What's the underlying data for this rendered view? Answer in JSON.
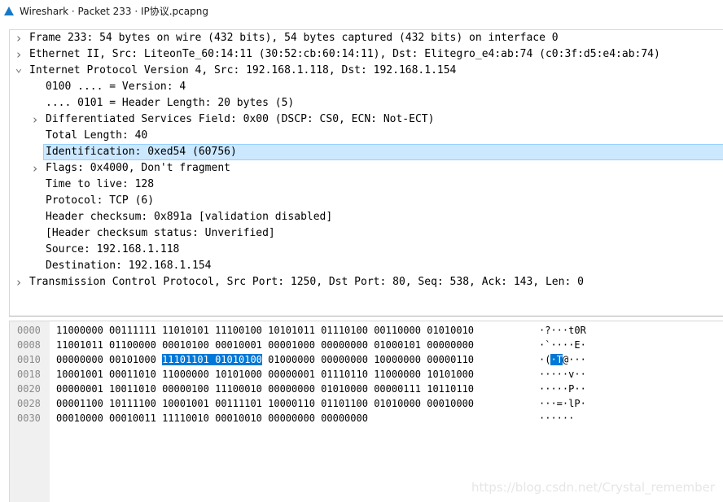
{
  "window": {
    "title": "Wireshark · Packet 233 · IP协议.pcapng"
  },
  "tree": [
    {
      "level": 0,
      "arrow": "collapsed",
      "text": "Frame 233: 54 bytes on wire (432 bits), 54 bytes captured (432 bits) on interface 0"
    },
    {
      "level": 0,
      "arrow": "collapsed",
      "text": "Ethernet II, Src: LiteonTe_60:14:11 (30:52:cb:60:14:11), Dst: Elitegro_e4:ab:74 (c0:3f:d5:e4:ab:74)"
    },
    {
      "level": 0,
      "arrow": "expanded",
      "text": "Internet Protocol Version 4, Src: 192.168.1.118, Dst: 192.168.1.154"
    },
    {
      "level": 1,
      "arrow": "none",
      "text": "0100 .... = Version: 4"
    },
    {
      "level": 1,
      "arrow": "none",
      "text": ".... 0101 = Header Length: 20 bytes (5)"
    },
    {
      "level": 1,
      "arrow": "collapsed",
      "text": "Differentiated Services Field: 0x00 (DSCP: CS0, ECN: Not-ECT)"
    },
    {
      "level": 1,
      "arrow": "none",
      "text": "Total Length: 40"
    },
    {
      "level": 1,
      "arrow": "none",
      "text": "Identification: 0xed54 (60756)",
      "selected": true
    },
    {
      "level": 1,
      "arrow": "collapsed",
      "text": "Flags: 0x4000, Don't fragment"
    },
    {
      "level": 1,
      "arrow": "none",
      "text": "Time to live: 128"
    },
    {
      "level": 1,
      "arrow": "none",
      "text": "Protocol: TCP (6)"
    },
    {
      "level": 1,
      "arrow": "none",
      "text": "Header checksum: 0x891a [validation disabled]"
    },
    {
      "level": 1,
      "arrow": "none",
      "text": "[Header checksum status: Unverified]"
    },
    {
      "level": 1,
      "arrow": "none",
      "text": "Source: 192.168.1.118"
    },
    {
      "level": 1,
      "arrow": "none",
      "text": "Destination: 192.168.1.154"
    },
    {
      "level": 0,
      "arrow": "collapsed",
      "text": "Transmission Control Protocol, Src Port: 1250, Dst Port: 80, Seq: 538, Ack: 143, Len: 0"
    }
  ],
  "hex": [
    {
      "offset": "0000",
      "bits": [
        "11000000",
        "00111111",
        "11010101",
        "11100100",
        "10101011",
        "01110100",
        "00110000",
        "01010010"
      ],
      "ascii": "·?···t0R"
    },
    {
      "offset": "0008",
      "bits": [
        "11001011",
        "01100000",
        "00010100",
        "00010001",
        "00001000",
        "00000000",
        "01000101",
        "00000000"
      ],
      "ascii": "·`····E·"
    },
    {
      "offset": "0010",
      "bits": [
        "00000000",
        "00101000",
        "11101101",
        "01010100",
        "01000000",
        "00000000",
        "10000000",
        "00000110"
      ],
      "ascii": "·(·T@···",
      "hl_bytes": [
        2,
        3
      ]
    },
    {
      "offset": "0018",
      "bits": [
        "10001001",
        "00011010",
        "11000000",
        "10101000",
        "00000001",
        "01110110",
        "11000000",
        "10101000"
      ],
      "ascii": "·····v··"
    },
    {
      "offset": "0020",
      "bits": [
        "00000001",
        "10011010",
        "00000100",
        "11100010",
        "00000000",
        "01010000",
        "00000111",
        "10110110"
      ],
      "ascii": "·····P··"
    },
    {
      "offset": "0028",
      "bits": [
        "00001100",
        "10111100",
        "10001001",
        "00111101",
        "10000110",
        "01101100",
        "01010000",
        "00010000"
      ],
      "ascii": "···=·lP·"
    },
    {
      "offset": "0030",
      "bits": [
        "00010000",
        "00010011",
        "11110010",
        "00010010",
        "00000000",
        "00000000"
      ],
      "ascii": "······"
    }
  ],
  "watermark": "https://blog.csdn.net/Crystal_remember"
}
